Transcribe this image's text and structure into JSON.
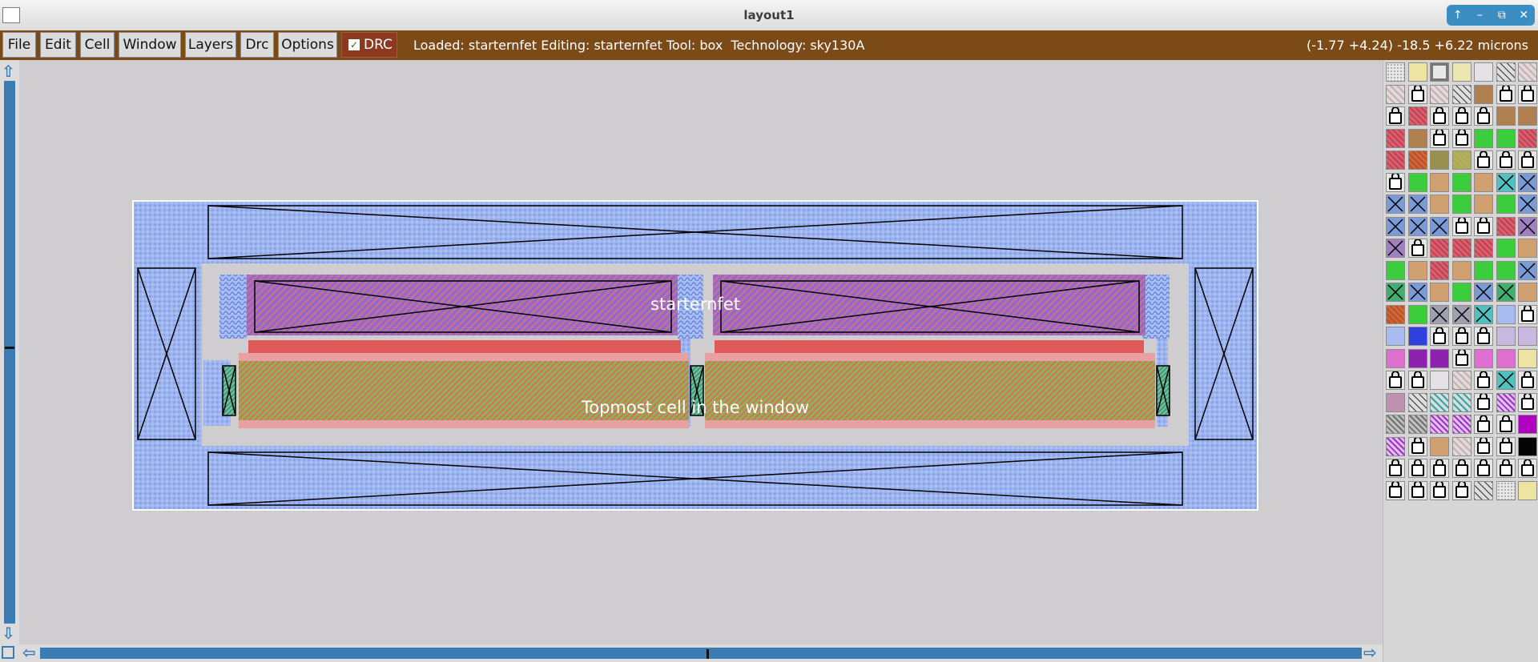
{
  "window": {
    "title": "layout1",
    "controls": [
      "↑",
      "–",
      "⧉",
      "✕"
    ]
  },
  "menubar": {
    "items": [
      {
        "label": "File"
      },
      {
        "label": "Edit"
      },
      {
        "label": "Cell"
      },
      {
        "label": "Window"
      },
      {
        "label": "Layers"
      },
      {
        "label": "Drc"
      },
      {
        "label": "Options"
      }
    ],
    "drc_toggle": {
      "label": "DRC",
      "checked": true
    },
    "status_text": "Loaded: starternfet Editing: starternfet Tool: box  Technology: sky130A",
    "coordinates_text": "(-1.77 +4.24) -18.5 +6.22 microns"
  },
  "layout": {
    "cell_label": "starternfet",
    "topmost_label": "Topmost cell in the window"
  },
  "colors": {
    "menubar_bg": "#7b4a17",
    "drc_bg": "#8c3920",
    "scrollbar": "#3c7cb4",
    "metal1": "#8fa8ee",
    "poly": "#e05a5a",
    "diff": "#9ab85a",
    "locali": "#b06ad0"
  },
  "palette": {
    "rows": [
      [
        "dots",
        "yellow",
        "hollow",
        "lightyellow",
        "light",
        "diag",
        "stripe"
      ],
      [
        "stripe",
        "lock",
        "stripe",
        "diag",
        "brown",
        "lock",
        "lock"
      ],
      [
        "lock",
        "red",
        "lock",
        "lock",
        "lock",
        "brown",
        "brown"
      ],
      [
        "red",
        "brown",
        "lock",
        "lock",
        "green",
        "green",
        "red"
      ],
      [
        "red",
        "orange",
        "olive",
        "lime",
        "lock",
        "lock",
        "lock"
      ],
      [
        "lock",
        "green",
        "tan",
        "green",
        "tan",
        "x-cyan",
        "x-blue"
      ],
      [
        "x-blue",
        "x-blue",
        "tan",
        "green",
        "tan",
        "green",
        "x-blue"
      ],
      [
        "x-blue",
        "x-blue",
        "x-blue",
        "lock",
        "lock",
        "red",
        "x-purple"
      ],
      [
        "x-purple",
        "lock",
        "red",
        "red",
        "red",
        "green",
        "tan"
      ],
      [
        "green",
        "tan",
        "red",
        "tan",
        "green",
        "green",
        "x-blue"
      ],
      [
        "x-green",
        "x-blue",
        "tan",
        "green",
        "x-blue",
        "x-green",
        "tan"
      ],
      [
        "orange",
        "green",
        "x-gray",
        "x-gray",
        "x-cyan",
        "lightblue",
        "lock"
      ],
      [
        "lightblue",
        "blue",
        "lock",
        "lock",
        "lock",
        "lavender",
        "lavender"
      ],
      [
        "pink",
        "purple",
        "purple",
        "lock",
        "pink",
        "pink",
        "yellow"
      ],
      [
        "lock",
        "lock",
        "light",
        "stripe",
        "lock",
        "x-cyan",
        "lock"
      ],
      [
        "mauve",
        "diag",
        "teal",
        "teal",
        "lock",
        "violet",
        "lock"
      ],
      [
        "gray",
        "gray",
        "violet",
        "violet",
        "lock",
        "lock",
        "magenta"
      ],
      [
        "violet",
        "lock",
        "tan",
        "stripe",
        "lock",
        "lock",
        "black"
      ],
      [
        "lock",
        "lock",
        "lock",
        "lock",
        "lock",
        "lock",
        "lock"
      ],
      [
        "lock",
        "lock",
        "lock",
        "lock",
        "diag",
        "dots",
        "yellow"
      ]
    ]
  }
}
